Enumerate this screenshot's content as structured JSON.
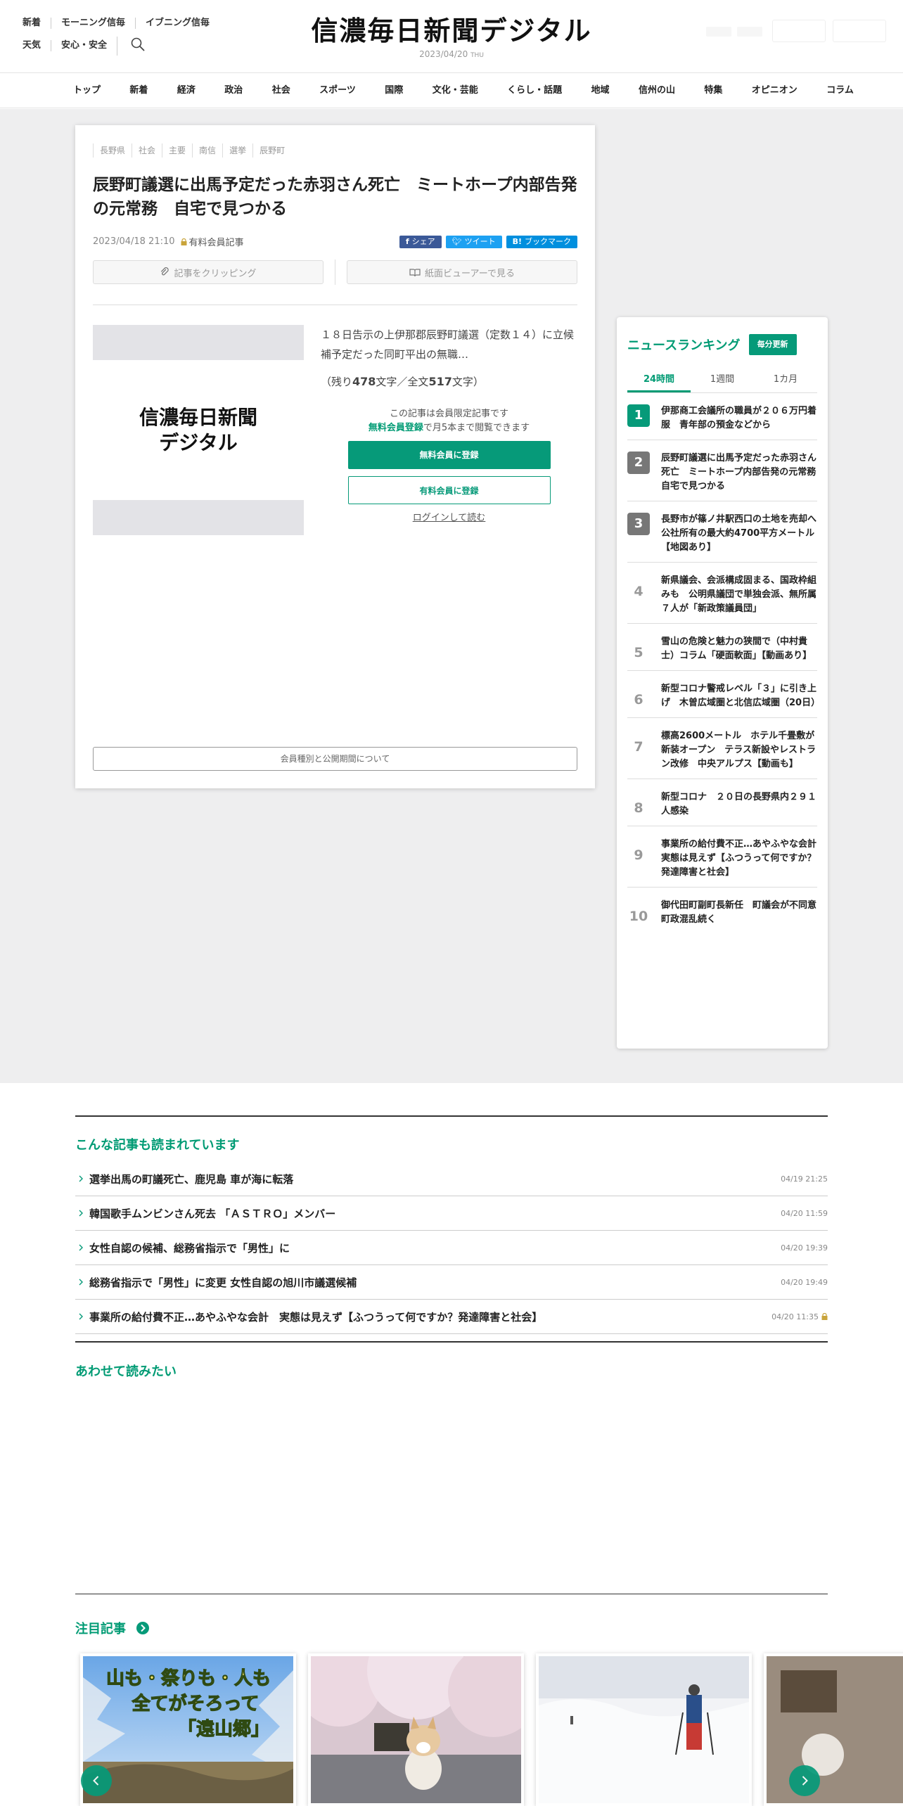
{
  "header": {
    "util_row1": [
      "新着",
      "モーニング信毎",
      "イブニング信毎"
    ],
    "util_row2": [
      "天気",
      "安心・安全"
    ],
    "logo": "信濃毎日新聞デジタル",
    "date": "2023/04/20",
    "weekday": "THU"
  },
  "nav": [
    "トップ",
    "新着",
    "経済",
    "政治",
    "社会",
    "スポーツ",
    "国際",
    "文化・芸能",
    "くらし・話題",
    "地域",
    "信州の山",
    "特集",
    "オピニオン",
    "コラム"
  ],
  "article": {
    "tags": [
      "長野県",
      "社会",
      "主要",
      "南信",
      "選挙",
      "辰野町"
    ],
    "headline": "辰野町議選に出馬予定だった赤羽さん死亡　ミートホープ内部告発の元常務　自宅で見つかる",
    "datetime": "2023/04/18 21:10",
    "premium_label": "有料会員記事",
    "share": {
      "facebook": "シェア",
      "twitter": "ツイート",
      "hatena": "ブックマーク"
    },
    "clip_label": "記事をクリッピング",
    "viewer_label": "紙面ビューアーで見る",
    "thumb_logo_line1": "信濃毎日新聞",
    "thumb_logo_line2": "デジタル",
    "lead": "１８日告示の上伊那郡辰野町議選（定数１４）に立候補予定だった同町平出の無職…",
    "remain_prefix": "（残り",
    "remain_count": "478",
    "remain_mid": "文字／全文",
    "total_count": "517",
    "remain_suffix": "文字）",
    "paywall_line1": "この記事は会員限定記事です",
    "paywall_free_link": "無料会員登録",
    "paywall_line2_rest": "で月5本まで閲覧できます",
    "btn_free": "無料会員に登録",
    "btn_paid": "有料会員に登録",
    "btn_login": "ログインして読む",
    "membership": "会員種別と公開期間について"
  },
  "ranking": {
    "title": "ニュースランキング",
    "badge": "毎分更新",
    "tabs": [
      "24時間",
      "1週間",
      "1カ月"
    ],
    "items": [
      {
        "rank": "1",
        "text": "伊那商工会議所の職員が２０６万円着服　青年部の預金などから"
      },
      {
        "rank": "2",
        "text": "辰野町議選に出馬予定だった赤羽さん死亡　ミートホープ内部告発の元常務　自宅で見つかる"
      },
      {
        "rank": "3",
        "text": "長野市が篠ノ井駅西口の土地を売却へ　公社所有の最大約4700平方メートル【地図あり】"
      },
      {
        "rank": "4",
        "text": "新県議会、会派構成固まる、国政枠組みも　公明県議団で単独会派、無所属７人が「新政策議員団」"
      },
      {
        "rank": "5",
        "text": "雪山の危険と魅力の狭間で（中村貴士）コラム「硬面軟面」【動画あり】"
      },
      {
        "rank": "6",
        "text": "新型コロナ警戒レベル「３」に引き上げ　木曽広域圏と北信広域圏（20日）"
      },
      {
        "rank": "7",
        "text": "標高2600メートル　ホテル千畳敷が新装オープン　テラス新設やレストラン改修　中央アルプス【動画も】"
      },
      {
        "rank": "8",
        "text": "新型コロナ　２０日の長野県内２９１人感染"
      },
      {
        "rank": "9",
        "text": "事業所の給付費不正…あやふやな会計　実態は見えず【ふつうって何ですか？発達障害と社会】"
      },
      {
        "rank": "10",
        "text": "御代田町副町長新任　町議会が不同意　町政混乱続く"
      }
    ]
  },
  "also_read": {
    "title": "こんな記事も読まれています",
    "items": [
      {
        "title": "選挙出馬の町議死亡、鹿児島 車が海に転落",
        "date": "04/19 21:25",
        "locked": false
      },
      {
        "title": "韓国歌手ムンビンさん死去 「ＡＳＴＲＯ」メンバー",
        "date": "04/20 11:59",
        "locked": false
      },
      {
        "title": "女性自認の候補、総務省指示で「男性」に",
        "date": "04/20 19:39",
        "locked": false
      },
      {
        "title": "総務省指示で「男性」に変更 女性自認の旭川市議選候補",
        "date": "04/20 19:49",
        "locked": false
      },
      {
        "title": "事業所の給付費不正…あやふやな会計　実態は見えず【ふつうって何ですか？発達障害と社会】",
        "date": "04/20 11:35",
        "locked": true
      }
    ]
  },
  "read_together": {
    "title": "あわせて読みたい"
  },
  "attention": {
    "title": "注目記事",
    "card1_text": [
      "山も・祭りも・人も",
      "全てがそろって",
      "「遠山郷」"
    ]
  },
  "colors": {
    "accent": "#069a79",
    "rank_gray": "#777777",
    "facebook": "#3b5998",
    "twitter": "#1da1f2",
    "hatena": "#008fde"
  }
}
